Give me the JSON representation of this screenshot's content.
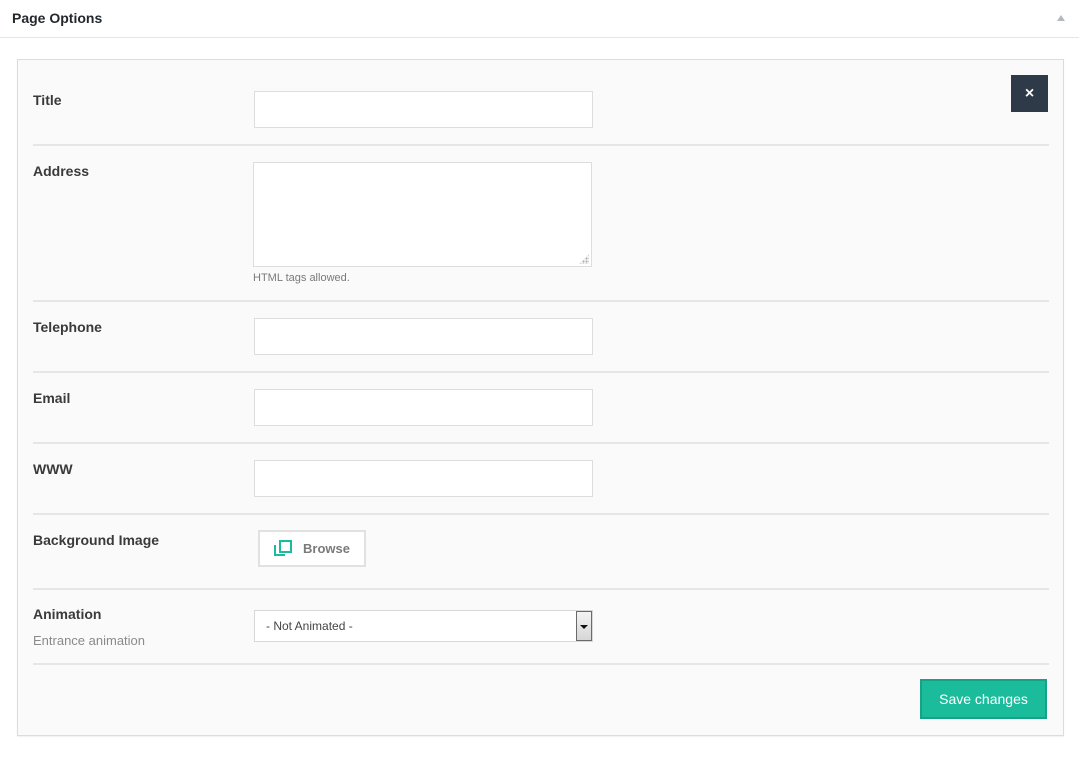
{
  "metabox": {
    "title": "Page Options",
    "toggle_icon": "collapse-arrow-icon"
  },
  "close_button": {
    "label": "×",
    "icon": "close-icon"
  },
  "fields": {
    "title": {
      "label": "Title",
      "value": ""
    },
    "address": {
      "label": "Address",
      "value": "",
      "hint": "HTML tags allowed."
    },
    "telephone": {
      "label": "Telephone",
      "value": ""
    },
    "email": {
      "label": "Email",
      "value": ""
    },
    "www": {
      "label": "WWW",
      "value": ""
    },
    "background_image": {
      "label": "Background Image",
      "button_label": "Browse",
      "icon": "media-browse-icon"
    },
    "animation": {
      "label": "Animation",
      "sublabel": "Entrance animation",
      "selected": "- Not Animated -"
    }
  },
  "save_button": {
    "label": "Save changes"
  },
  "colors": {
    "accent": "#1bbc9b",
    "close_bg": "#2f3a48",
    "panel_bg": "#fafafa"
  }
}
